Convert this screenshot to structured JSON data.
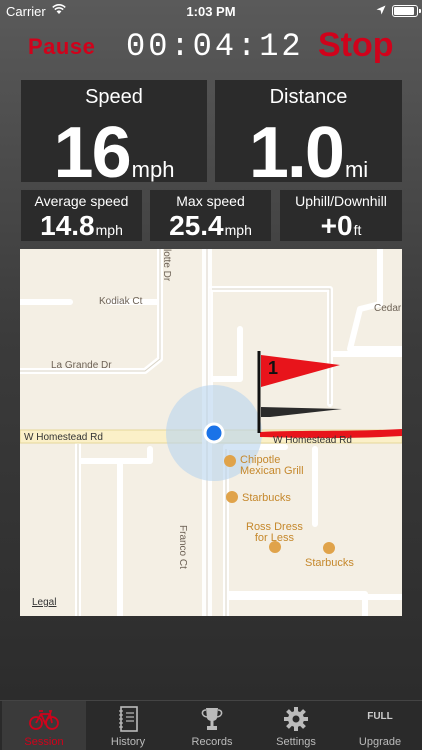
{
  "status_bar": {
    "carrier": "Carrier",
    "time": "1:03 PM"
  },
  "controls": {
    "pause_label": "Pause",
    "timer": "00:04:12",
    "stop_label": "Stop"
  },
  "stats": {
    "speed": {
      "label": "Speed",
      "value": "16",
      "unit": "mph"
    },
    "distance": {
      "label": "Distance",
      "value": "1.0",
      "unit": "mi"
    },
    "average_speed": {
      "label": "Average speed",
      "value": "14.8",
      "unit": "mph"
    },
    "max_speed": {
      "label": "Max speed",
      "value": "25.4",
      "unit": "mph"
    },
    "elevation": {
      "label": "Uphill/Downhill",
      "value": "+0",
      "unit": "ft"
    }
  },
  "map": {
    "streets": [
      "Kodiak Ct",
      "La Grande Dr",
      "W Homestead Rd",
      "W Homestead Rd",
      "Franco Ct",
      "Cedar",
      "lotte Dr"
    ],
    "pois": [
      "Chipotle\nMexican Grill",
      "Starbucks",
      "Ross Dress\nfor Less",
      "Starbucks"
    ],
    "flag_number": "1",
    "legal": "Legal",
    "route_color": "#e8141b",
    "location_color": "#1a73e8"
  },
  "tabs": [
    {
      "label": "Session",
      "icon": "bicycle-icon",
      "active": true
    },
    {
      "label": "History",
      "icon": "notebook-icon",
      "active": false
    },
    {
      "label": "Records",
      "icon": "trophy-icon",
      "active": false
    },
    {
      "label": "Settings",
      "icon": "gear-icon",
      "active": false
    },
    {
      "label": "Upgrade",
      "icon": "full-badge",
      "badge": "FULL",
      "active": false
    }
  ],
  "colors": {
    "accent": "#d0021b",
    "tile_bg": "#2b2b2b"
  }
}
